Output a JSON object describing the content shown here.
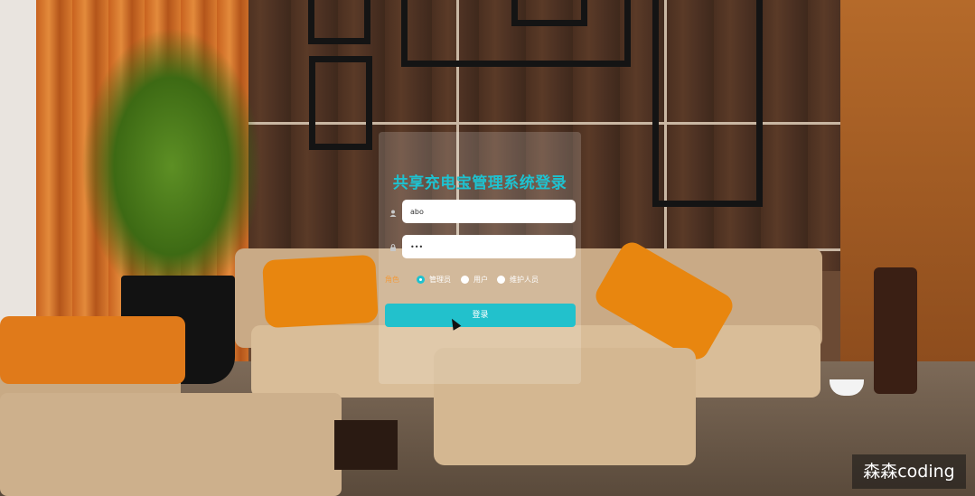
{
  "login": {
    "title": "共享充电宝管理系统登录",
    "username_value": "abo",
    "password_value": "•••",
    "role_label": "角色",
    "roles": [
      {
        "label": "管理员",
        "checked": true
      },
      {
        "label": "用户",
        "checked": false
      },
      {
        "label": "维护人员",
        "checked": false
      }
    ],
    "submit_label": "登录"
  },
  "colors": {
    "accent": "#1ec2d0",
    "role_label": "#f29a3a"
  },
  "icons": {
    "username": "user-icon",
    "password": "lock-icon"
  },
  "watermark": "森森coding"
}
